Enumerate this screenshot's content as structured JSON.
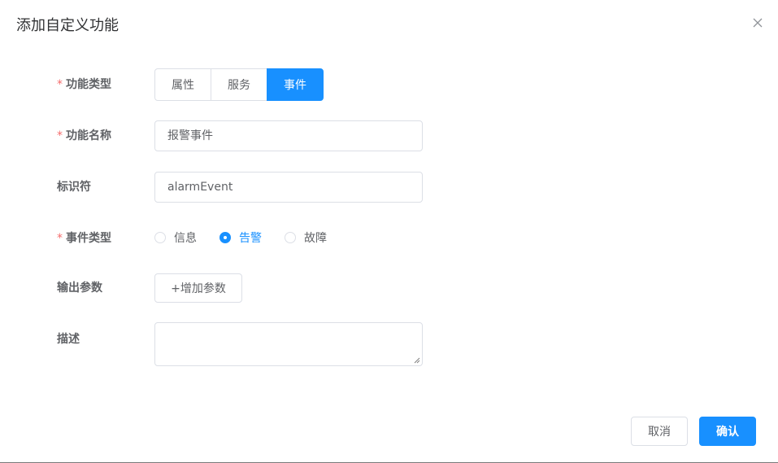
{
  "dialog": {
    "title": "添加自定义功能"
  },
  "form": {
    "function_type": {
      "label": "功能类型",
      "required": "*",
      "options": [
        "属性",
        "服务",
        "事件"
      ],
      "selected": "事件"
    },
    "function_name": {
      "label": "功能名称",
      "required": "*",
      "value": "报警事件"
    },
    "identifier": {
      "label": "标识符",
      "value": "alarmEvent"
    },
    "event_type": {
      "label": "事件类型",
      "required": "*",
      "options": [
        "信息",
        "告警",
        "故障"
      ],
      "selected": "告警"
    },
    "output_params": {
      "label": "输出参数",
      "add_label": "+增加参数"
    },
    "description": {
      "label": "描述",
      "value": ""
    }
  },
  "footer": {
    "cancel_label": "取消",
    "confirm_label": "确认"
  },
  "colors": {
    "primary": "#1890ff",
    "required": "#f56c6c",
    "border": "#dcdfe6",
    "text": "#606266"
  },
  "icons": {
    "close": "close-icon"
  }
}
